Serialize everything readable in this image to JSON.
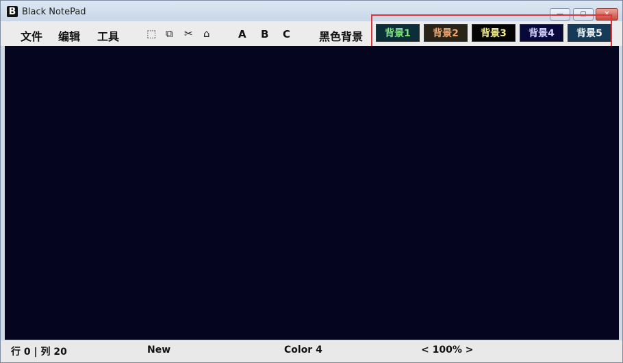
{
  "window": {
    "logo": "B",
    "title": "Black NotePad",
    "controls": [
      "minimize-icon",
      "maximize-icon",
      "close-icon"
    ]
  },
  "menu": {
    "file": "文件",
    "edit": "编辑",
    "tools": "工具"
  },
  "toolbar": {
    "icons": [
      "select-all-icon",
      "copy-icon",
      "cut-icon",
      "paste-icon"
    ],
    "font_a": "A",
    "font_b": "B",
    "font_c": "C",
    "black_background": "黑色背景"
  },
  "backgrounds": [
    {
      "label": "背景1",
      "bg": "#0b2e38",
      "fg": "#7ee27c"
    },
    {
      "label": "背景2",
      "bg": "#2a2418",
      "fg": "#f0a56d"
    },
    {
      "label": "背景3",
      "bg": "#050505",
      "fg": "#f6ef85"
    },
    {
      "label": "背景4",
      "bg": "#08083a",
      "fg": "#d3d3ff"
    },
    {
      "label": "背景5",
      "bg": "#153b59",
      "fg": "#f3f3f3"
    }
  ],
  "colors": {
    "editor_bg": "#05051f",
    "highlight": "#e2333a"
  },
  "status": {
    "position": "行 0 | 列 20",
    "file_state": "New",
    "color": "Color 4",
    "zoom": "< 100% >"
  }
}
